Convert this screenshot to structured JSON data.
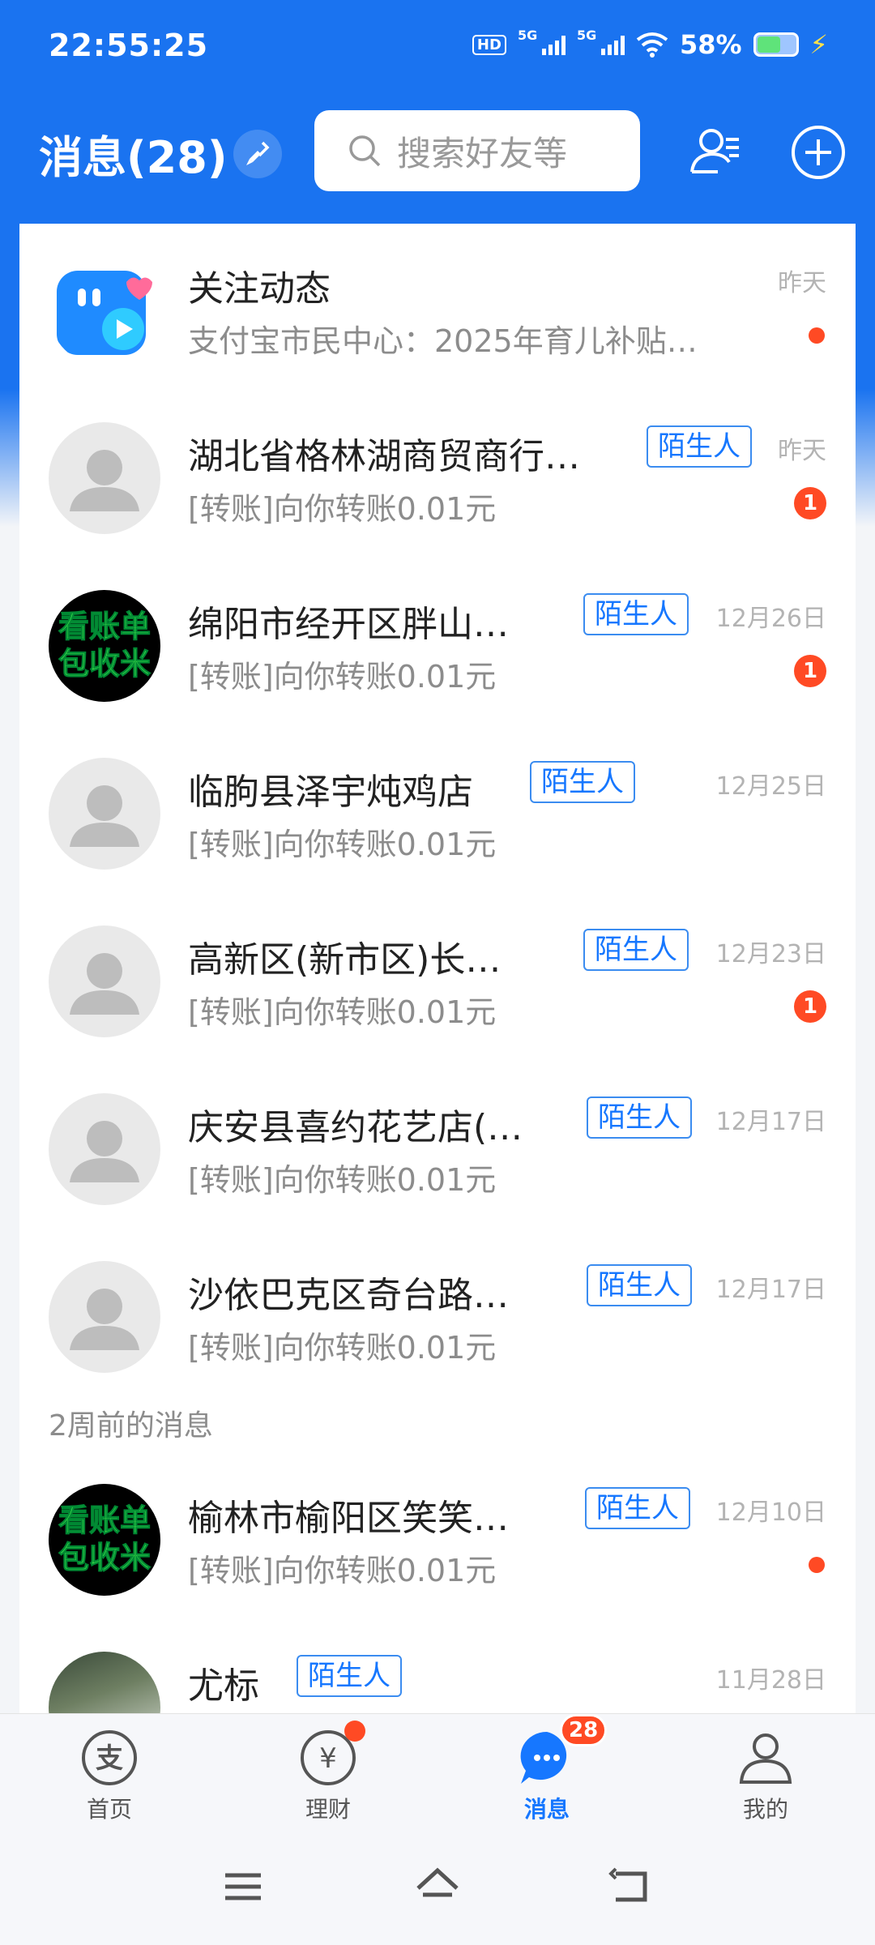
{
  "status_bar": {
    "time": "22:55:25",
    "hd": "HD",
    "net1": "5G",
    "net2": "5G",
    "battery": "58%"
  },
  "header": {
    "title": "消息(28)",
    "search_placeholder": "搜索好友等",
    "icons": [
      "broom-icon",
      "contacts-icon",
      "plus-icon"
    ]
  },
  "messages": [
    {
      "name": "关注动态",
      "preview": "支付宝市民中心：2025年育儿补贴…",
      "time": "昨天",
      "indicator": "dot"
    },
    {
      "name": "湖北省格林湖商贸商行…",
      "tag": "陌生人",
      "preview": "[转账]向你转账0.01元",
      "time": "昨天",
      "badge": "1"
    },
    {
      "name": "绵阳市经开区胖山…",
      "tag": "陌生人",
      "preview": "[转账]向你转账0.01元",
      "time": "12月26日",
      "badge": "1",
      "avatar_text": [
        "看账单",
        "包收米"
      ]
    },
    {
      "name": "临朐县泽宇炖鸡店",
      "tag": "陌生人",
      "preview": "[转账]向你转账0.01元",
      "time": "12月25日"
    },
    {
      "name": "高新区(新市区)长…",
      "tag": "陌生人",
      "preview": "[转账]向你转账0.01元",
      "time": "12月23日",
      "badge": "1"
    },
    {
      "name": "庆安县喜约花艺店(…",
      "tag": "陌生人",
      "preview": "[转账]向你转账0.01元",
      "time": "12月17日"
    },
    {
      "name": "沙依巴克区奇台路…",
      "tag": "陌生人",
      "preview": "[转账]向你转账0.01元",
      "time": "12月17日"
    }
  ],
  "section_label": "2周前的消息",
  "older_messages": [
    {
      "name": "榆林市榆阳区笑笑…",
      "tag": "陌生人",
      "preview": "[转账]向你转账0.01元",
      "time": "12月10日",
      "indicator": "dot",
      "avatar_text": [
        "看账单",
        "包收米"
      ]
    },
    {
      "name": "尤标",
      "tag": "陌生人",
      "preview": "",
      "time": "11月28日"
    }
  ],
  "bottom_nav": [
    {
      "label": "首页",
      "icon": "alipay-icon"
    },
    {
      "label": "理财",
      "icon": "yuan-icon",
      "dot": true
    },
    {
      "label": "消息",
      "icon": "chat-icon",
      "badge": "28",
      "active": true
    },
    {
      "label": "我的",
      "icon": "person-icon"
    }
  ],
  "colors": {
    "brand": "#1a73f0",
    "badge": "#ff4a24",
    "tag": "#1677ff"
  }
}
